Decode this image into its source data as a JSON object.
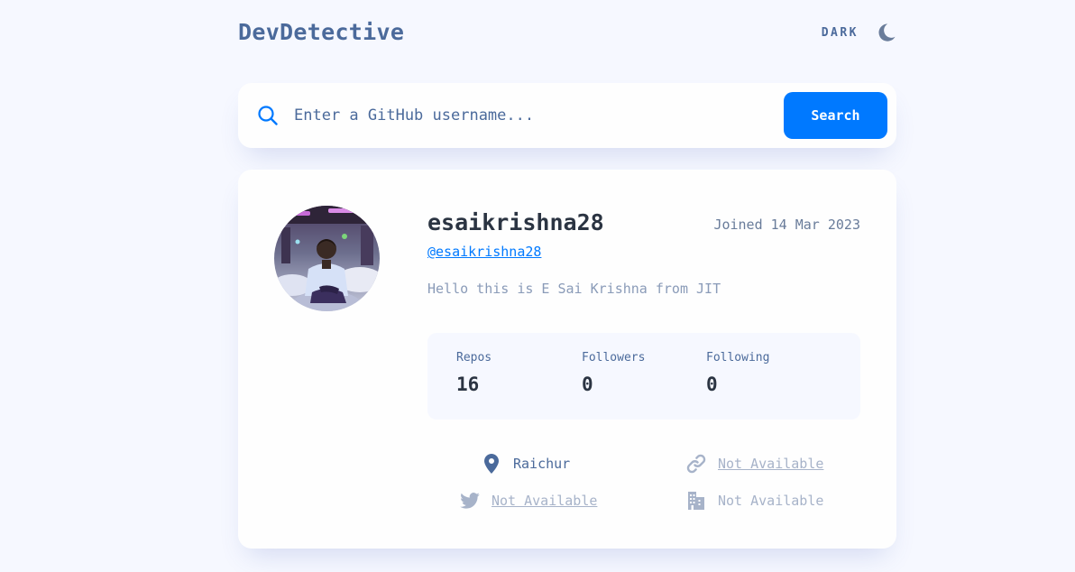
{
  "header": {
    "brand": "DevDetective",
    "theme_label": "DARK",
    "theme_icon": "moon-icon"
  },
  "search": {
    "placeholder": "Enter a GitHub username...",
    "value": "",
    "button_label": "Search",
    "icon": "search-icon"
  },
  "profile": {
    "name": "esaikrishna28",
    "login": "@esaikrishna28",
    "joined": "Joined 14 Mar 2023",
    "bio": "Hello this is E Sai Krishna from JIT",
    "stats": [
      {
        "label": "Repos",
        "value": "16"
      },
      {
        "label": "Followers",
        "value": "0"
      },
      {
        "label": "Following",
        "value": "0"
      }
    ],
    "info": {
      "location": "Raichur",
      "blog": "Not Available",
      "twitter": "Not Available",
      "company": "Not Available"
    }
  },
  "colors": {
    "accent": "#0079ff",
    "background": "#f6f8ff",
    "card": "#fefefe",
    "heading": "#2b3442",
    "text": "#4b6a9b",
    "muted": "#a7b3c9"
  }
}
